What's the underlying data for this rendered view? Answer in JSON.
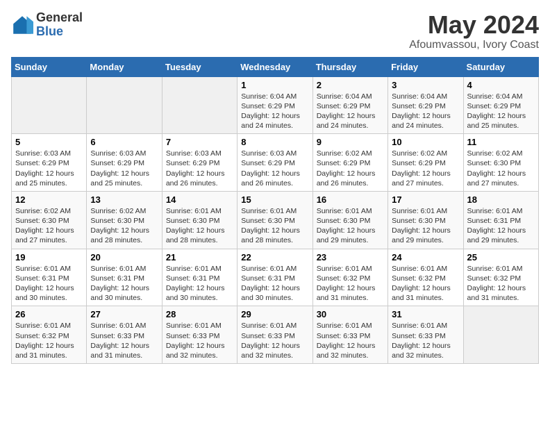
{
  "logo": {
    "general": "General",
    "blue": "Blue"
  },
  "title": "May 2024",
  "subtitle": "Afoumvassou, Ivory Coast",
  "days_of_week": [
    "Sunday",
    "Monday",
    "Tuesday",
    "Wednesday",
    "Thursday",
    "Friday",
    "Saturday"
  ],
  "weeks": [
    [
      {
        "day": "",
        "empty": true
      },
      {
        "day": "",
        "empty": true
      },
      {
        "day": "",
        "empty": true
      },
      {
        "day": "1",
        "sunrise": "6:04 AM",
        "sunset": "6:29 PM",
        "daylight": "12 hours and 24 minutes."
      },
      {
        "day": "2",
        "sunrise": "6:04 AM",
        "sunset": "6:29 PM",
        "daylight": "12 hours and 24 minutes."
      },
      {
        "day": "3",
        "sunrise": "6:04 AM",
        "sunset": "6:29 PM",
        "daylight": "12 hours and 24 minutes."
      },
      {
        "day": "4",
        "sunrise": "6:04 AM",
        "sunset": "6:29 PM",
        "daylight": "12 hours and 25 minutes."
      }
    ],
    [
      {
        "day": "5",
        "sunrise": "6:03 AM",
        "sunset": "6:29 PM",
        "daylight": "12 hours and 25 minutes."
      },
      {
        "day": "6",
        "sunrise": "6:03 AM",
        "sunset": "6:29 PM",
        "daylight": "12 hours and 25 minutes."
      },
      {
        "day": "7",
        "sunrise": "6:03 AM",
        "sunset": "6:29 PM",
        "daylight": "12 hours and 26 minutes."
      },
      {
        "day": "8",
        "sunrise": "6:03 AM",
        "sunset": "6:29 PM",
        "daylight": "12 hours and 26 minutes."
      },
      {
        "day": "9",
        "sunrise": "6:02 AM",
        "sunset": "6:29 PM",
        "daylight": "12 hours and 26 minutes."
      },
      {
        "day": "10",
        "sunrise": "6:02 AM",
        "sunset": "6:29 PM",
        "daylight": "12 hours and 27 minutes."
      },
      {
        "day": "11",
        "sunrise": "6:02 AM",
        "sunset": "6:30 PM",
        "daylight": "12 hours and 27 minutes."
      }
    ],
    [
      {
        "day": "12",
        "sunrise": "6:02 AM",
        "sunset": "6:30 PM",
        "daylight": "12 hours and 27 minutes."
      },
      {
        "day": "13",
        "sunrise": "6:02 AM",
        "sunset": "6:30 PM",
        "daylight": "12 hours and 28 minutes."
      },
      {
        "day": "14",
        "sunrise": "6:01 AM",
        "sunset": "6:30 PM",
        "daylight": "12 hours and 28 minutes."
      },
      {
        "day": "15",
        "sunrise": "6:01 AM",
        "sunset": "6:30 PM",
        "daylight": "12 hours and 28 minutes."
      },
      {
        "day": "16",
        "sunrise": "6:01 AM",
        "sunset": "6:30 PM",
        "daylight": "12 hours and 29 minutes."
      },
      {
        "day": "17",
        "sunrise": "6:01 AM",
        "sunset": "6:30 PM",
        "daylight": "12 hours and 29 minutes."
      },
      {
        "day": "18",
        "sunrise": "6:01 AM",
        "sunset": "6:31 PM",
        "daylight": "12 hours and 29 minutes."
      }
    ],
    [
      {
        "day": "19",
        "sunrise": "6:01 AM",
        "sunset": "6:31 PM",
        "daylight": "12 hours and 30 minutes."
      },
      {
        "day": "20",
        "sunrise": "6:01 AM",
        "sunset": "6:31 PM",
        "daylight": "12 hours and 30 minutes."
      },
      {
        "day": "21",
        "sunrise": "6:01 AM",
        "sunset": "6:31 PM",
        "daylight": "12 hours and 30 minutes."
      },
      {
        "day": "22",
        "sunrise": "6:01 AM",
        "sunset": "6:31 PM",
        "daylight": "12 hours and 30 minutes."
      },
      {
        "day": "23",
        "sunrise": "6:01 AM",
        "sunset": "6:32 PM",
        "daylight": "12 hours and 31 minutes."
      },
      {
        "day": "24",
        "sunrise": "6:01 AM",
        "sunset": "6:32 PM",
        "daylight": "12 hours and 31 minutes."
      },
      {
        "day": "25",
        "sunrise": "6:01 AM",
        "sunset": "6:32 PM",
        "daylight": "12 hours and 31 minutes."
      }
    ],
    [
      {
        "day": "26",
        "sunrise": "6:01 AM",
        "sunset": "6:32 PM",
        "daylight": "12 hours and 31 minutes."
      },
      {
        "day": "27",
        "sunrise": "6:01 AM",
        "sunset": "6:33 PM",
        "daylight": "12 hours and 31 minutes."
      },
      {
        "day": "28",
        "sunrise": "6:01 AM",
        "sunset": "6:33 PM",
        "daylight": "12 hours and 32 minutes."
      },
      {
        "day": "29",
        "sunrise": "6:01 AM",
        "sunset": "6:33 PM",
        "daylight": "12 hours and 32 minutes."
      },
      {
        "day": "30",
        "sunrise": "6:01 AM",
        "sunset": "6:33 PM",
        "daylight": "12 hours and 32 minutes."
      },
      {
        "day": "31",
        "sunrise": "6:01 AM",
        "sunset": "6:33 PM",
        "daylight": "12 hours and 32 minutes."
      },
      {
        "day": "",
        "empty": true
      }
    ]
  ],
  "labels": {
    "sunrise": "Sunrise:",
    "sunset": "Sunset:",
    "daylight": "Daylight:"
  }
}
